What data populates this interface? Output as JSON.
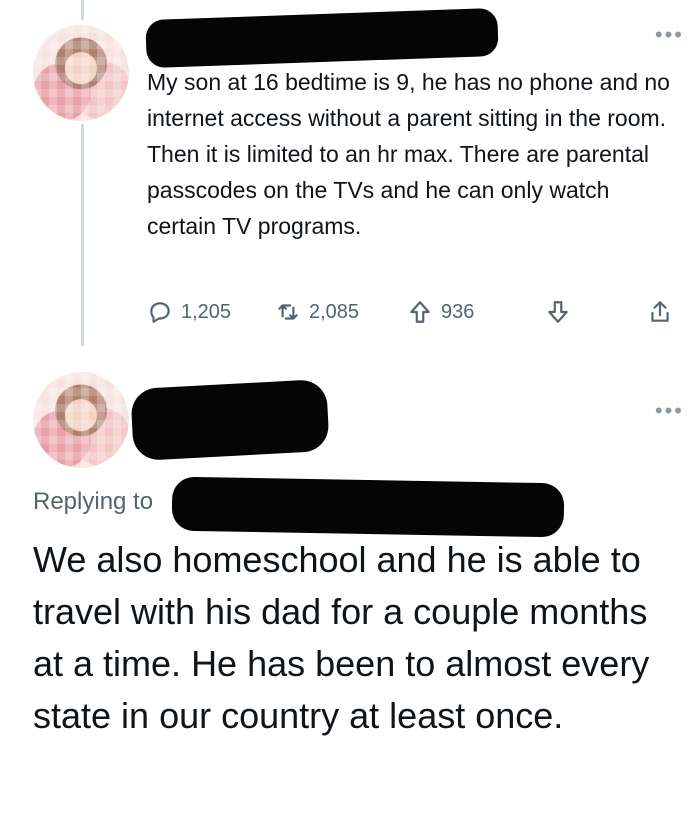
{
  "tweet1": {
    "text": "My son at 16 bedtime is 9, he has no phone and no internet access without a parent sitting in the room. Then it is limited to an hr max.  There are parental passcodes on the TVs and he can only watch certain TV programs.",
    "more_icon": "more-dots-icon",
    "actions": {
      "reply_count": "1,205",
      "retweet_count": "2,085",
      "upvote_count": "936"
    }
  },
  "tweet2": {
    "replying_to": "Replying to",
    "text": "We also homeschool and he is able to travel with his dad for a couple months at a time. He has been to almost every state in our country at least once.",
    "more_icon": "more-dots-icon"
  },
  "colors": {
    "text": "#0f1419",
    "secondary": "#536471",
    "thread_line": "#cfd9de",
    "redaction": "#050505"
  }
}
